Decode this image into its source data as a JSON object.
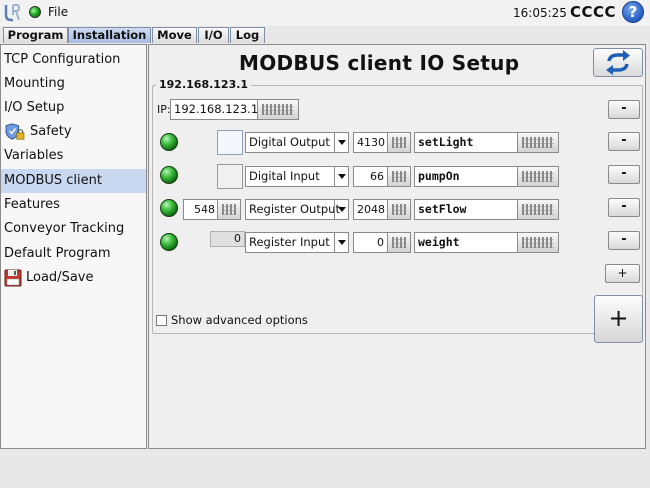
{
  "topbar": {
    "file_label": "File",
    "clock": "16:05:25",
    "robot_name": "CCCC",
    "help_glyph": "?"
  },
  "tabs": [
    {
      "label": "Program",
      "active": false
    },
    {
      "label": "Installation",
      "active": true
    },
    {
      "label": "Move",
      "active": false
    },
    {
      "label": "I/O",
      "active": false
    },
    {
      "label": "Log",
      "active": false
    }
  ],
  "sidebar": {
    "items": [
      {
        "label": "TCP Configuration",
        "icon": ""
      },
      {
        "label": "Mounting",
        "icon": ""
      },
      {
        "label": "I/O Setup",
        "icon": ""
      },
      {
        "label": "Safety",
        "icon": "shield-lock-icon"
      },
      {
        "label": "Variables",
        "icon": ""
      },
      {
        "label": "MODBUS client",
        "icon": "",
        "active": true
      },
      {
        "label": "Features",
        "icon": ""
      },
      {
        "label": "Conveyor Tracking",
        "icon": ""
      },
      {
        "label": "Default Program",
        "icon": ""
      },
      {
        "label": "Load/Save",
        "icon": "floppy-disk-icon"
      }
    ]
  },
  "main": {
    "title": "MODBUS client IO Setup",
    "server": {
      "ip_title": "192.168.123.1",
      "ip_label": "IP:",
      "ip_value": "192.168.123.1",
      "minus_label": "-"
    },
    "signals": [
      {
        "type": "Digital Output",
        "address": "4130",
        "name": "setLight",
        "value": "",
        "has_toggle": true,
        "toggle_state": "on",
        "minus_label": "-"
      },
      {
        "type": "Digital Input",
        "address": "66",
        "name": "pumpOn",
        "value": "",
        "has_toggle": true,
        "toggle_state": "off",
        "minus_label": "-"
      },
      {
        "type": "Register Output",
        "address": "2048",
        "name": "setFlow",
        "value": "548",
        "has_toggle": false,
        "minus_label": "-"
      },
      {
        "type": "Register Input",
        "address": "0",
        "name": "weight",
        "value": "0",
        "has_toggle": false,
        "minus_label": "-"
      }
    ],
    "add_signal_label": "+",
    "show_advanced_label": "Show advanced options",
    "show_advanced_checked": false,
    "add_server_label": "+"
  },
  "colors": {
    "accent": "#a9bde3",
    "active_sidebar": "#c9d8f1",
    "led_green": "#3fbf3f",
    "help_blue": "#2e65c9",
    "refresh_blue": "#1f5fb5"
  }
}
